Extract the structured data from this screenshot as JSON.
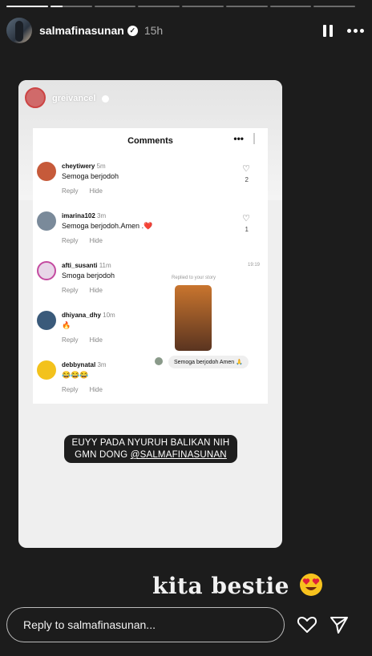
{
  "progress": {
    "segments": 8,
    "current_index": 1,
    "current_progress": 0.3
  },
  "header": {
    "username": "salmafinasunan",
    "verified": true,
    "time_ago": "15h",
    "icons": {
      "pause": "pause-icon",
      "more": "more-options-icon",
      "verified": "verified-badge-icon"
    }
  },
  "reshared_story": {
    "author": "greivancel",
    "verified": true,
    "comments_panel": {
      "title": "Comments",
      "comments": [
        {
          "user": "cheytiwery",
          "ago": "5m",
          "text": "Semoga berjodoh",
          "likes": "2",
          "actions": [
            "Reply",
            "Hide"
          ]
        },
        {
          "user": "imarina102",
          "ago": "3m",
          "text": "Semoga berjodoh.Amen .❤️",
          "likes": "1",
          "actions": [
            "Reply",
            "Hide"
          ]
        },
        {
          "user": "afti_susanti",
          "ago": "11m",
          "text": "Smoga berjodoh",
          "likes": "",
          "actions": [
            "Reply",
            "Hide"
          ]
        },
        {
          "user": "dhiyana_dhy",
          "ago": "10m",
          "text": "🔥",
          "likes": "",
          "actions": [
            "Reply",
            "Hide"
          ]
        },
        {
          "user": "debbynatal",
          "ago": "3m",
          "text": "😂😂😂",
          "likes": "",
          "actions": [
            "Reply",
            "Hide"
          ]
        }
      ]
    },
    "reply_preview": {
      "time": "19:19",
      "label": "Replied to your story",
      "message": "Semoga berjodoh Amen 🙏"
    },
    "sticker_text_line1": "EUYY PADA NYURUH BALIKAN NIH",
    "sticker_text_line2_prefix": "GMN DONG ",
    "sticker_mention": "@SALMAFINASUNAN"
  },
  "caption": "kita bestie",
  "caption_emoji": "heart-eyes-emoji",
  "reply_bar": {
    "placeholder": "Reply to salmafinasunan...",
    "like_icon": "heart-icon",
    "share_icon": "send-icon"
  }
}
